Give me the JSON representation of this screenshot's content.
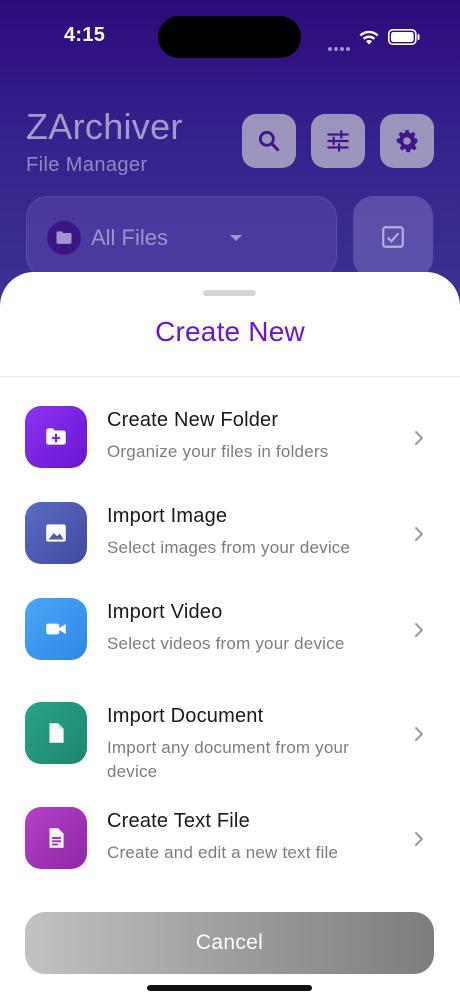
{
  "status_bar": {
    "time": "4:15"
  },
  "header": {
    "app_title": "ZArchiver",
    "app_subtitle": "File Manager",
    "filter_label": "All Files"
  },
  "sheet": {
    "title": "Create New",
    "options": [
      {
        "title": "Create New Folder",
        "description": "Organize your files in folders",
        "icon": "folder-plus-icon",
        "color": "#7b22e4"
      },
      {
        "title": "Import Image",
        "description": "Select images from your device",
        "icon": "image-icon",
        "color": "#4c5bb2"
      },
      {
        "title": "Import Video",
        "description": "Select videos from your device",
        "icon": "video-camera-icon",
        "color": "#3a95ef"
      },
      {
        "title": "Import Document",
        "description": "Import any document from your device",
        "icon": "document-icon",
        "color": "#22957b"
      },
      {
        "title": "Create Text File",
        "description": "Create and edit a new text file",
        "icon": "text-file-icon",
        "color": "#a234ba"
      }
    ],
    "cancel_label": "Cancel"
  },
  "colors": {
    "accent": "#6b15d6",
    "header_bg": "#2c0a7a"
  }
}
